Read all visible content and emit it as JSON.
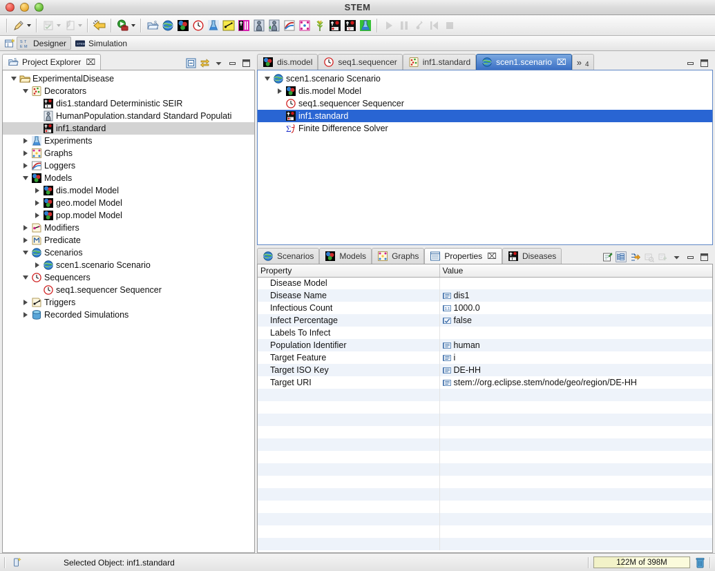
{
  "window": {
    "title": "STEM"
  },
  "toolbar": {
    "groups": [
      {
        "items": [
          {
            "name": "new-wizard-dropdown",
            "icon": "pencil-icon",
            "caret": true,
            "enabled": true
          }
        ]
      },
      {
        "items": [
          {
            "name": "save-dropdown",
            "icon": "save-icon",
            "caret": true,
            "enabled": false
          },
          {
            "name": "import-dropdown",
            "icon": "import-icon",
            "caret": true,
            "enabled": false
          }
        ]
      },
      {
        "items": [
          {
            "name": "back-button",
            "icon": "yellow-arrow-icon",
            "caret": false,
            "enabled": true
          }
        ]
      },
      {
        "items": [
          {
            "name": "run-dropdown",
            "icon": "run-icon",
            "caret": true,
            "enabled": true
          }
        ]
      },
      {
        "items": [
          {
            "name": "new-project-button",
            "icon": "project-icon",
            "enabled": true
          },
          {
            "name": "new-scenario-button",
            "icon": "globe-icon",
            "enabled": true
          },
          {
            "name": "new-model-button",
            "icon": "model-icon",
            "enabled": true
          },
          {
            "name": "new-sequencer-button",
            "icon": "clock-icon",
            "enabled": true
          },
          {
            "name": "new-experiment-button",
            "icon": "flask-icon",
            "enabled": true
          },
          {
            "name": "new-trigger-button",
            "icon": "trigger-icon",
            "enabled": true
          },
          {
            "name": "new-disease-button",
            "icon": "disease-icon",
            "enabled": true
          },
          {
            "name": "new-population-button",
            "icon": "population-icon",
            "enabled": true
          },
          {
            "name": "new-population-initializer-button",
            "icon": "population-init-icon",
            "enabled": true
          },
          {
            "name": "new-logger-button",
            "icon": "logger-icon",
            "enabled": true
          },
          {
            "name": "new-graph-button",
            "icon": "graph-icon",
            "enabled": true
          },
          {
            "name": "new-food-production-button",
            "icon": "wheat-icon",
            "enabled": true
          },
          {
            "name": "new-infector-button",
            "icon": "infector-icon",
            "enabled": true
          },
          {
            "name": "new-vaccine-button",
            "icon": "vaccine-icon",
            "enabled": true
          },
          {
            "name": "new-analysis-button",
            "icon": "analysis-icon",
            "enabled": true
          }
        ]
      },
      {
        "items": [
          {
            "name": "play-button",
            "icon": "play-icon",
            "enabled": false
          },
          {
            "name": "pause-button",
            "icon": "pause-icon",
            "enabled": false
          },
          {
            "name": "step-button",
            "icon": "step-icon",
            "enabled": false
          },
          {
            "name": "reset-button",
            "icon": "reset-icon",
            "enabled": false
          },
          {
            "name": "stop-button",
            "icon": "stop-icon",
            "enabled": false
          }
        ]
      }
    ]
  },
  "perspective": {
    "new_icon": "new-perspective-icon",
    "items": [
      {
        "label": "Designer",
        "icon": "stem-designer-icon",
        "active": true
      },
      {
        "label": "Simulation",
        "icon": "stem-simulation-icon",
        "active": false
      }
    ]
  },
  "project_explorer": {
    "tab_label": "Project Explorer",
    "tab_icon": "project-icon",
    "close_glyph": "⌧",
    "tools": [
      {
        "name": "collapse-all-button",
        "icon": "collapse-all-icon"
      },
      {
        "name": "link-with-editor-button",
        "icon": "link-editor-icon"
      },
      {
        "name": "view-menu-button",
        "icon": "chevron-down-icon"
      },
      {
        "name": "minimize-button",
        "icon": "minimize-icon"
      },
      {
        "name": "maximize-button",
        "icon": "maximize-icon"
      }
    ],
    "tree": [
      {
        "label": "ExperimentalDisease",
        "icon": "folder-open-icon",
        "indent": 0,
        "twist": "down",
        "selected": false
      },
      {
        "label": "Decorators",
        "icon": "decorator-icon",
        "indent": 1,
        "twist": "down",
        "selected": false
      },
      {
        "label": "dis1.standard Deterministic SEIR",
        "icon": "disease-icon",
        "indent": 2,
        "twist": "none",
        "selected": false
      },
      {
        "label": "HumanPopulation.standard Standard Populati",
        "icon": "population-icon",
        "indent": 2,
        "twist": "none",
        "selected": false
      },
      {
        "label": "inf1.standard",
        "icon": "infector-icon",
        "indent": 2,
        "twist": "none",
        "selected": true
      },
      {
        "label": "Experiments",
        "icon": "flask-icon",
        "indent": 1,
        "twist": "right",
        "selected": false
      },
      {
        "label": "Graphs",
        "icon": "graph-icon",
        "indent": 1,
        "twist": "right",
        "selected": false
      },
      {
        "label": "Loggers",
        "icon": "logger-icon",
        "indent": 1,
        "twist": "right",
        "selected": false
      },
      {
        "label": "Models",
        "icon": "model-icon",
        "indent": 1,
        "twist": "down",
        "selected": false
      },
      {
        "label": "dis.model Model",
        "icon": "model-icon",
        "indent": 2,
        "twist": "right",
        "selected": false
      },
      {
        "label": "geo.model Model",
        "icon": "model-icon",
        "indent": 2,
        "twist": "right",
        "selected": false
      },
      {
        "label": "pop.model Model",
        "icon": "model-icon",
        "indent": 2,
        "twist": "right",
        "selected": false
      },
      {
        "label": "Modifiers",
        "icon": "modifier-icon",
        "indent": 1,
        "twist": "right",
        "selected": false
      },
      {
        "label": "Predicate",
        "icon": "predicate-icon",
        "indent": 1,
        "twist": "right",
        "selected": false
      },
      {
        "label": "Scenarios",
        "icon": "globe-icon",
        "indent": 1,
        "twist": "down",
        "selected": false
      },
      {
        "label": "scen1.scenario Scenario",
        "icon": "globe-icon",
        "indent": 2,
        "twist": "right",
        "selected": false
      },
      {
        "label": "Sequencers",
        "icon": "clock-icon",
        "indent": 1,
        "twist": "down",
        "selected": false
      },
      {
        "label": "seq1.sequencer Sequencer",
        "icon": "clock-icon",
        "indent": 2,
        "twist": "none",
        "selected": false
      },
      {
        "label": "Triggers",
        "icon": "trigger-icon",
        "indent": 1,
        "twist": "right",
        "selected": false
      },
      {
        "label": "Recorded Simulations",
        "icon": "database-icon",
        "indent": 1,
        "twist": "right",
        "selected": false
      }
    ]
  },
  "editor": {
    "tabs": [
      {
        "label": "dis.model",
        "icon": "model-icon",
        "active": false
      },
      {
        "label": "seq1.sequencer",
        "icon": "clock-icon",
        "active": false
      },
      {
        "label": "inf1.standard",
        "icon": "decorator-icon",
        "active": false
      },
      {
        "label": "scen1.scenario",
        "icon": "globe-icon",
        "active": true
      }
    ],
    "close_glyph": "⌧",
    "overflow_glyph": "»",
    "overflow_count": "4",
    "tools": [
      {
        "name": "minimize-button",
        "icon": "minimize-icon"
      },
      {
        "name": "maximize-button",
        "icon": "maximize-icon"
      }
    ],
    "tree": [
      {
        "label": "scen1.scenario Scenario",
        "icon": "globe-icon",
        "indent": 0,
        "twist": "down",
        "selected": false
      },
      {
        "label": "dis.model Model",
        "icon": "model-icon",
        "indent": 1,
        "twist": "right",
        "selected": false
      },
      {
        "label": "seq1.sequencer Sequencer",
        "icon": "clock-icon",
        "indent": 1,
        "twist": "none",
        "selected": false
      },
      {
        "label": "inf1.standard",
        "icon": "infector-icon",
        "indent": 1,
        "twist": "none",
        "selected": true
      },
      {
        "label": "Finite Difference Solver",
        "icon": "solver-icon",
        "indent": 1,
        "twist": "none",
        "selected": false
      }
    ]
  },
  "properties_view": {
    "tabs": [
      {
        "label": "Scenarios",
        "icon": "globe-icon",
        "active": false,
        "closable": false
      },
      {
        "label": "Models",
        "icon": "model-icon",
        "active": false,
        "closable": false
      },
      {
        "label": "Graphs",
        "icon": "graph-icon",
        "active": false,
        "closable": false
      },
      {
        "label": "Properties",
        "icon": "properties-icon",
        "active": true,
        "closable": true
      },
      {
        "label": "Diseases",
        "icon": "disease-icon",
        "active": false,
        "closable": false
      }
    ],
    "close_glyph": "⌧",
    "tools": [
      {
        "name": "new-property-sheet-button",
        "icon": "new-sheet-icon",
        "enabled": true,
        "toggled": false
      },
      {
        "name": "show-categories-button",
        "icon": "categories-icon",
        "enabled": true,
        "toggled": true
      },
      {
        "name": "show-advanced-button",
        "icon": "advanced-icon",
        "enabled": true,
        "toggled": false
      },
      {
        "name": "restore-default-button",
        "icon": "restore-icon",
        "enabled": false,
        "toggled": false
      },
      {
        "name": "pin-button",
        "icon": "pin-icon",
        "enabled": false,
        "toggled": false
      },
      {
        "name": "view-menu-button",
        "icon": "chevron-down-icon",
        "enabled": true,
        "toggled": false
      },
      {
        "name": "minimize-button",
        "icon": "minimize-icon",
        "enabled": true,
        "toggled": false
      },
      {
        "name": "maximize-button",
        "icon": "maximize-icon",
        "enabled": true,
        "toggled": false
      }
    ],
    "columns": [
      "Property",
      "Value"
    ],
    "rows": [
      {
        "property": "Disease Model",
        "value": "",
        "value_icon": "none"
      },
      {
        "property": "Disease Name",
        "value": "dis1",
        "value_icon": "string-icon"
      },
      {
        "property": "Infectious Count",
        "value": "1000.0",
        "value_icon": "number-icon"
      },
      {
        "property": "Infect Percentage",
        "value": "false",
        "value_icon": "boolean-icon"
      },
      {
        "property": "Labels To Infect",
        "value": "",
        "value_icon": "none"
      },
      {
        "property": "Population Identifier",
        "value": "human",
        "value_icon": "string-icon"
      },
      {
        "property": "Target Feature",
        "value": "i",
        "value_icon": "string-icon"
      },
      {
        "property": "Target ISO Key",
        "value": "DE-HH",
        "value_icon": "string-icon"
      },
      {
        "property": "Target URI",
        "value": "stem://org.eclipse.stem/node/geo/region/DE-HH",
        "value_icon": "string-icon"
      }
    ],
    "empty_row_count": 13
  },
  "status_bar": {
    "icon": "selected-object-icon",
    "message": "Selected Object: inf1.standard",
    "heap": {
      "label": "122M of 398M",
      "used_percent": 31
    },
    "trash_icon": "trash-icon"
  }
}
